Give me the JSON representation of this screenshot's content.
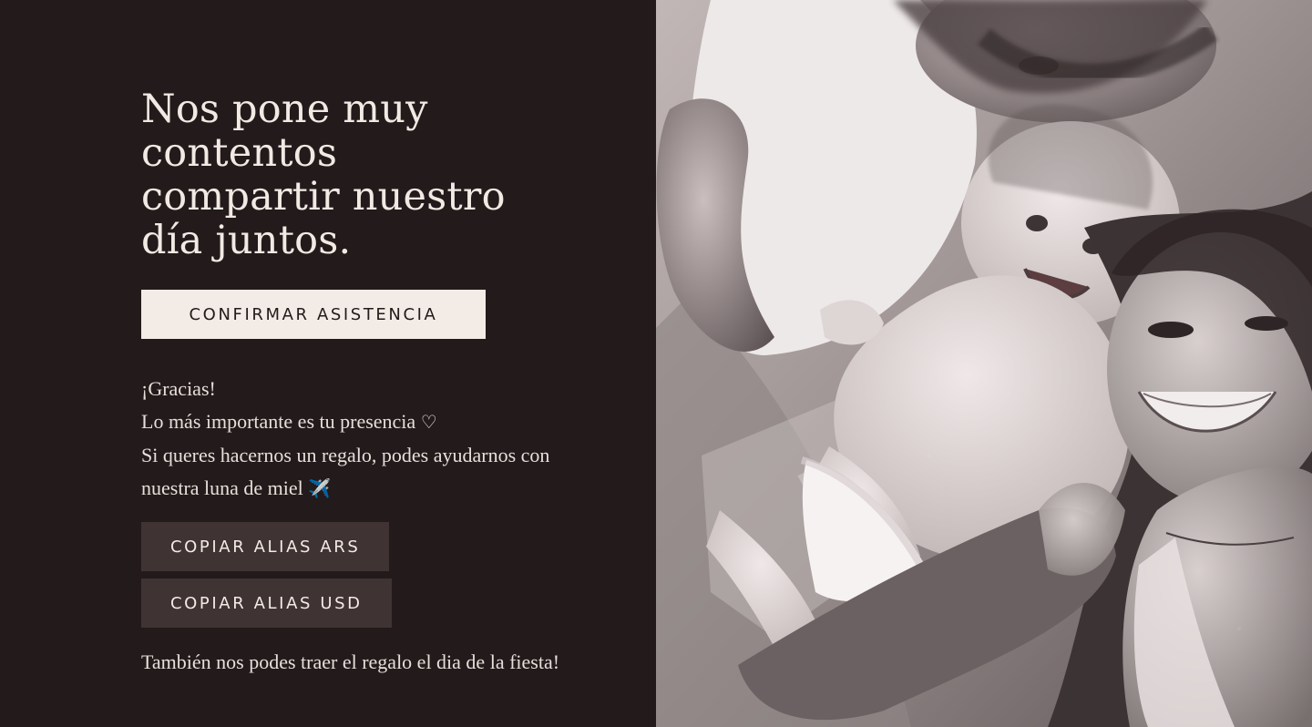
{
  "headline": "Nos pone muy contentos compartir nuestro día juntos.",
  "confirm_button": "CONFIRMAR ASISTENCIA",
  "message": {
    "line1": "¡Gracias!",
    "line2": "Lo más importante es tu presencia",
    "heart_icon": "♡",
    "line3": "Si queres hacernos un regalo, podes ayudarnos con",
    "line4": "nuestra luna de miel",
    "plane_icon": "✈️"
  },
  "alias_buttons": {
    "ars": "COPIAR ALIAS ARS",
    "usd": "COPIAR ALIAS USD"
  },
  "footer_note": "También nos podes traer el regalo el dia de la fiesta!",
  "photo": {
    "icon": "family-photo",
    "tone": "sepia-monochrome"
  },
  "colors": {
    "background": "#231a1b",
    "confirm_bg": "#f3ebe5",
    "alias_bg": "#3f3334",
    "text": "#f1e9e3"
  }
}
